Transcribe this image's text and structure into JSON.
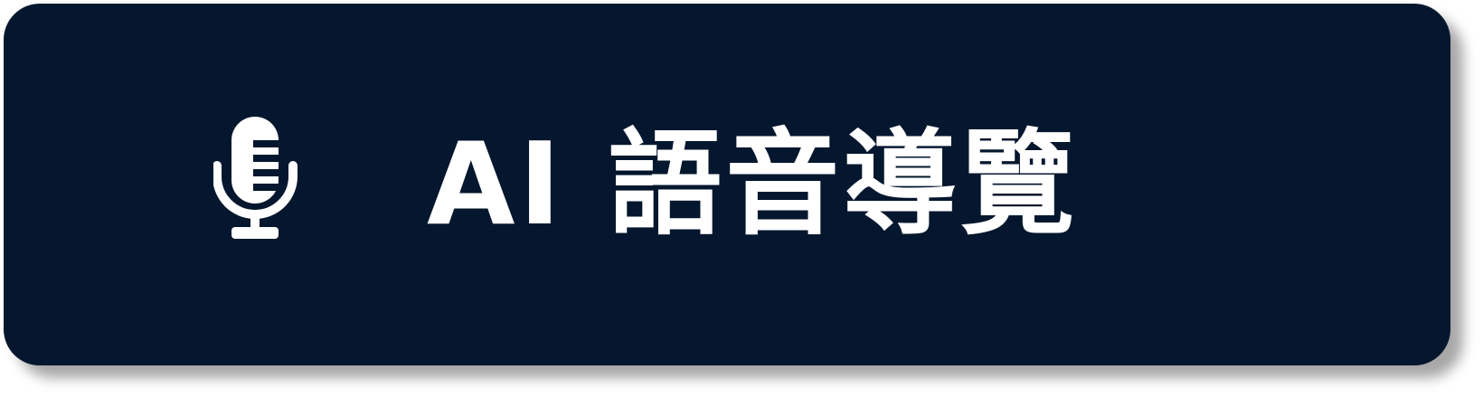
{
  "button": {
    "label": "AI 語音導覽",
    "icon": "microphone-icon",
    "background_color": "#04172e",
    "text_color": "#ffffff"
  }
}
